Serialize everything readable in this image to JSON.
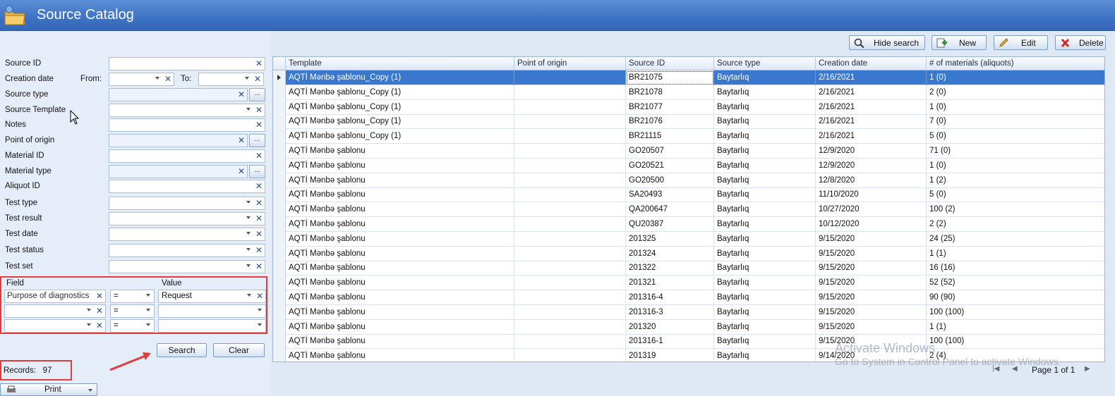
{
  "window": {
    "title": "Source Catalog"
  },
  "filters": {
    "source_id": "Source ID",
    "creation_date": "Creation date",
    "from": "From:",
    "to": "To:",
    "source_type": "Source type",
    "source_template": "Source Template",
    "notes": "Notes",
    "point_of_origin": "Point of origin",
    "material_id": "Material ID",
    "material_type": "Material type",
    "aliquot_id": "Aliquot ID",
    "test_type": "Test type",
    "test_result": "Test result",
    "test_date": "Test date",
    "test_status": "Test status",
    "test_set": "Test set",
    "ellipsis": "..."
  },
  "advanced": {
    "field_header": "Field",
    "value_header": "Value",
    "rows": [
      {
        "field": "Purpose of diagnostics",
        "op": "=",
        "value": "Request"
      },
      {
        "field": "",
        "op": "=",
        "value": ""
      },
      {
        "field": "",
        "op": "=",
        "value": ""
      }
    ]
  },
  "actions": {
    "search": "Search",
    "clear": "Clear"
  },
  "records": {
    "label": "Records:",
    "count": "97"
  },
  "print": {
    "label": "Print"
  },
  "toolbar": {
    "hide_search": "Hide search",
    "new": "New",
    "edit": "Edit",
    "delete": "Delete"
  },
  "grid": {
    "columns": [
      "Template",
      "Point of origin",
      "Source ID",
      "Source type",
      "Creation date",
      "# of materials (aliquots)"
    ],
    "rows": [
      [
        "AQTİ Mənbə şablonu_Copy (1)",
        "",
        "BR21075",
        "Baytarlıq",
        "2/16/2021",
        "1 (0)"
      ],
      [
        "AQTİ Mənbə şablonu_Copy (1)",
        "",
        "BR21078",
        "Baytarlıq",
        "2/16/2021",
        "2 (0)"
      ],
      [
        "AQTİ Mənbə şablonu_Copy (1)",
        "",
        "BR21077",
        "Baytarlıq",
        "2/16/2021",
        "1 (0)"
      ],
      [
        "AQTİ Mənbə şablonu_Copy (1)",
        "",
        "BR21076",
        "Baytarlıq",
        "2/16/2021",
        "7 (0)"
      ],
      [
        "AQTİ Mənbə şablonu_Copy (1)",
        "",
        "BR21115",
        "Baytarlıq",
        "2/16/2021",
        "5 (0)"
      ],
      [
        "AQTİ Mənbə şablonu",
        "",
        "GO20507",
        "Baytarlıq",
        "12/9/2020",
        "71 (0)"
      ],
      [
        "AQTİ Mənbə şablonu",
        "",
        "GO20521",
        "Baytarlıq",
        "12/9/2020",
        "1 (0)"
      ],
      [
        "AQTİ Mənbə şablonu",
        "",
        "GO20500",
        "Baytarlıq",
        "12/8/2020",
        "1 (2)"
      ],
      [
        "AQTİ Mənbə şablonu",
        "",
        "SA20493",
        "Baytarlıq",
        "11/10/2020",
        "5 (0)"
      ],
      [
        "AQTİ Mənbə şablonu",
        "",
        "QA200647",
        "Baytarlıq",
        "10/27/2020",
        "100 (2)"
      ],
      [
        "AQTİ Mənbə şablonu",
        "",
        "QU20387",
        "Baytarlıq",
        "10/12/2020",
        "2 (2)"
      ],
      [
        "AQTİ Mənbə şablonu",
        "",
        "201325",
        "Baytarlıq",
        "9/15/2020",
        "24 (25)"
      ],
      [
        "AQTİ Mənbə şablonu",
        "",
        "201324",
        "Baytarlıq",
        "9/15/2020",
        "1 (1)"
      ],
      [
        "AQTİ Mənbə şablonu",
        "",
        "201322",
        "Baytarlıq",
        "9/15/2020",
        "16 (16)"
      ],
      [
        "AQTİ Mənbə şablonu",
        "",
        "201321",
        "Baytarlıq",
        "9/15/2020",
        "52 (52)"
      ],
      [
        "AQTİ Mənbə şablonu",
        "",
        "201316-4",
        "Baytarlıq",
        "9/15/2020",
        "90 (90)"
      ],
      [
        "AQTİ Mənbə şablonu",
        "",
        "201316-3",
        "Baytarlıq",
        "9/15/2020",
        "100 (100)"
      ],
      [
        "AQTİ Mənbə şablonu",
        "",
        "201320",
        "Baytarlıq",
        "9/15/2020",
        "1 (1)"
      ],
      [
        "AQTİ Mənbə şablonu",
        "",
        "201316-1",
        "Baytarlıq",
        "9/15/2020",
        "100 (100)"
      ],
      [
        "AQTİ Mənbə şablonu",
        "",
        "201319",
        "Baytarlıq",
        "9/14/2020",
        "2 (4)"
      ]
    ]
  },
  "pager": {
    "page": "Page 1 of 1"
  },
  "watermark": {
    "line1": "Activate Windows",
    "line2": "Go to System in Control Panel to activate Windows."
  },
  "colors": {
    "title_bar": "#3d72c4",
    "selected_row": "#3a78d0",
    "highlight": "#e23b3b"
  }
}
